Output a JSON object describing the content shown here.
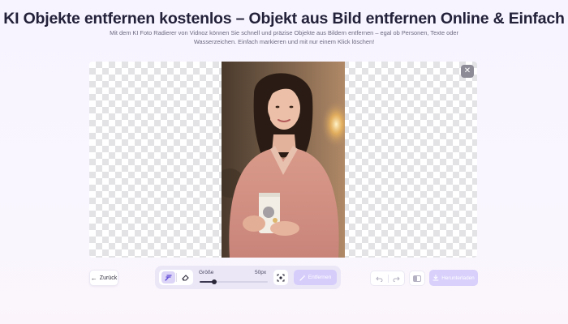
{
  "header": {
    "title": "KI Objekte entfernen kostenlos – Objekt aus Bild entfernen Online & Einfach",
    "subtitle": "Mit dem KI Foto Radierer von Vidnoz können Sie schnell und präzise Objekte aus Bildern entfernen – egal ob Personen, Texte oder Wasserzeichen. Einfach markieren und mit nur einem Klick löschen!"
  },
  "editor": {
    "close_icon": "close-icon",
    "photo_subject": "woman-holding-cup-photo"
  },
  "toolbar": {
    "back_label": "Zurück",
    "size_label": "Größe",
    "size_value": "50px",
    "slider_level": 0.22,
    "remove_label": "Entfernen",
    "download_label": "Herunterladen"
  },
  "icons": {
    "back": "arrow-left-icon",
    "brush": "brush-icon",
    "eraser": "eraser-icon",
    "scan": "scan-select-icon",
    "remove": "magic-wand-icon",
    "undo": "undo-icon",
    "redo": "redo-icon",
    "compare": "compare-icon",
    "download": "download-icon"
  },
  "colors": {
    "accent": "#7c5cf5",
    "accent_disabled": "#d7cdfb",
    "title": "#23213a"
  }
}
